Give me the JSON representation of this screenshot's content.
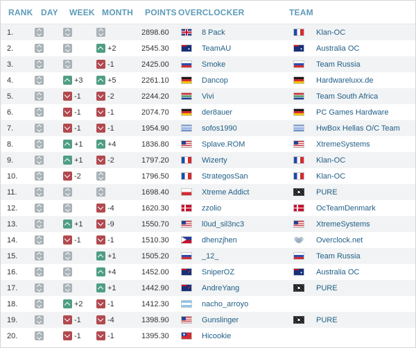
{
  "headers": {
    "rank": "RANK",
    "day": "DAY",
    "week": "WEEK",
    "month": "MONTH",
    "points": "POINTS",
    "overclocker": "OVERCLOCKER",
    "team": "TEAM"
  },
  "rows": [
    {
      "rank": "1.",
      "day": {
        "dir": "same",
        "delta": ""
      },
      "week": {
        "dir": "same",
        "delta": ""
      },
      "month": {
        "dir": "same",
        "delta": ""
      },
      "points": "2898.60",
      "oc_flag": "gb",
      "overclocker": "8 Pack",
      "team_flag": "fr",
      "team": "Klan-OC"
    },
    {
      "rank": "2.",
      "day": {
        "dir": "same",
        "delta": ""
      },
      "week": {
        "dir": "same",
        "delta": ""
      },
      "month": {
        "dir": "up",
        "delta": "+2"
      },
      "points": "2545.30",
      "oc_flag": "au",
      "overclocker": "TeamAU",
      "team_flag": "au",
      "team": "Australia OC"
    },
    {
      "rank": "3.",
      "day": {
        "dir": "same",
        "delta": ""
      },
      "week": {
        "dir": "same",
        "delta": ""
      },
      "month": {
        "dir": "down",
        "delta": "-1"
      },
      "points": "2425.00",
      "oc_flag": "ru",
      "overclocker": "Smoke",
      "team_flag": "ru",
      "team": "Team Russia"
    },
    {
      "rank": "4.",
      "day": {
        "dir": "same",
        "delta": ""
      },
      "week": {
        "dir": "up",
        "delta": "+3"
      },
      "month": {
        "dir": "up",
        "delta": "+5"
      },
      "points": "2261.10",
      "oc_flag": "de",
      "overclocker": "Dancop",
      "team_flag": "de",
      "team": "Hardwareluxx.de"
    },
    {
      "rank": "5.",
      "day": {
        "dir": "same",
        "delta": ""
      },
      "week": {
        "dir": "down",
        "delta": "-1"
      },
      "month": {
        "dir": "down",
        "delta": "-2"
      },
      "points": "2244.20",
      "oc_flag": "za",
      "overclocker": "Vivi",
      "team_flag": "za",
      "team": "Team South Africa"
    },
    {
      "rank": "6.",
      "day": {
        "dir": "same",
        "delta": ""
      },
      "week": {
        "dir": "down",
        "delta": "-1"
      },
      "month": {
        "dir": "down",
        "delta": "-1"
      },
      "points": "2074.70",
      "oc_flag": "de",
      "overclocker": "der8auer",
      "team_flag": "de",
      "team": "PC Games Hardware"
    },
    {
      "rank": "7.",
      "day": {
        "dir": "same",
        "delta": ""
      },
      "week": {
        "dir": "down",
        "delta": "-1"
      },
      "month": {
        "dir": "down",
        "delta": "-1"
      },
      "points": "1954.90",
      "oc_flag": "gr",
      "overclocker": "sofos1990",
      "team_flag": "gr",
      "team": "HwBox Hellas O/C Team"
    },
    {
      "rank": "8.",
      "day": {
        "dir": "same",
        "delta": ""
      },
      "week": {
        "dir": "up",
        "delta": "+1"
      },
      "month": {
        "dir": "up",
        "delta": "+4"
      },
      "points": "1836.80",
      "oc_flag": "us",
      "overclocker": "Splave.ROM",
      "team_flag": "us",
      "team": "XtremeSystems"
    },
    {
      "rank": "9.",
      "day": {
        "dir": "same",
        "delta": ""
      },
      "week": {
        "dir": "up",
        "delta": "+1"
      },
      "month": {
        "dir": "down",
        "delta": "-2"
      },
      "points": "1797.20",
      "oc_flag": "fr",
      "overclocker": "Wizerty",
      "team_flag": "fr",
      "team": "Klan-OC"
    },
    {
      "rank": "10.",
      "day": {
        "dir": "same",
        "delta": ""
      },
      "week": {
        "dir": "down",
        "delta": "-2"
      },
      "month": {
        "dir": "same",
        "delta": ""
      },
      "points": "1796.50",
      "oc_flag": "fr",
      "overclocker": "StrategosSan",
      "team_flag": "fr",
      "team": "Klan-OC"
    },
    {
      "rank": "11.",
      "day": {
        "dir": "same",
        "delta": ""
      },
      "week": {
        "dir": "same",
        "delta": ""
      },
      "month": {
        "dir": "same",
        "delta": ""
      },
      "points": "1698.40",
      "oc_flag": "pl",
      "overclocker": "Xtreme Addict",
      "team_flag": "pure",
      "team": "PURE"
    },
    {
      "rank": "12.",
      "day": {
        "dir": "same",
        "delta": ""
      },
      "week": {
        "dir": "same",
        "delta": ""
      },
      "month": {
        "dir": "down",
        "delta": "-4"
      },
      "points": "1620.30",
      "oc_flag": "dk",
      "overclocker": "zzolio",
      "team_flag": "dk",
      "team": "OcTeamDenmark"
    },
    {
      "rank": "13.",
      "day": {
        "dir": "same",
        "delta": ""
      },
      "week": {
        "dir": "up",
        "delta": "+1"
      },
      "month": {
        "dir": "down",
        "delta": "-9"
      },
      "points": "1550.70",
      "oc_flag": "us",
      "overclocker": "l0ud_sil3nc3",
      "team_flag": "us",
      "team": "XtremeSystems"
    },
    {
      "rank": "14.",
      "day": {
        "dir": "same",
        "delta": ""
      },
      "week": {
        "dir": "down",
        "delta": "-1"
      },
      "month": {
        "dir": "down",
        "delta": "-1"
      },
      "points": "1510.30",
      "oc_flag": "ph",
      "overclocker": "dhenzjhen",
      "team_flag": "oc",
      "team": "Overclock.net"
    },
    {
      "rank": "15.",
      "day": {
        "dir": "same",
        "delta": ""
      },
      "week": {
        "dir": "same",
        "delta": ""
      },
      "month": {
        "dir": "up",
        "delta": "+1"
      },
      "points": "1505.20",
      "oc_flag": "ru",
      "overclocker": "_12_",
      "team_flag": "ru",
      "team": "Team Russia"
    },
    {
      "rank": "16.",
      "day": {
        "dir": "same",
        "delta": ""
      },
      "week": {
        "dir": "same",
        "delta": ""
      },
      "month": {
        "dir": "up",
        "delta": "+4"
      },
      "points": "1452.00",
      "oc_flag": "nz",
      "overclocker": "SniperOZ",
      "team_flag": "au",
      "team": "Australia OC"
    },
    {
      "rank": "17.",
      "day": {
        "dir": "same",
        "delta": ""
      },
      "week": {
        "dir": "same",
        "delta": ""
      },
      "month": {
        "dir": "up",
        "delta": "+1"
      },
      "points": "1442.90",
      "oc_flag": "nz",
      "overclocker": "AndreYang",
      "team_flag": "pure",
      "team": "PURE"
    },
    {
      "rank": "18.",
      "day": {
        "dir": "same",
        "delta": ""
      },
      "week": {
        "dir": "up",
        "delta": "+2"
      },
      "month": {
        "dir": "down",
        "delta": "-1"
      },
      "points": "1412.30",
      "oc_flag": "ar",
      "overclocker": "nacho_arroyo",
      "team_flag": "",
      "team": ""
    },
    {
      "rank": "19.",
      "day": {
        "dir": "same",
        "delta": ""
      },
      "week": {
        "dir": "down",
        "delta": "-1"
      },
      "month": {
        "dir": "down",
        "delta": "-4"
      },
      "points": "1398.90",
      "oc_flag": "us",
      "overclocker": "Gunslinger",
      "team_flag": "pure",
      "team": "PURE"
    },
    {
      "rank": "20.",
      "day": {
        "dir": "same",
        "delta": ""
      },
      "week": {
        "dir": "down",
        "delta": "-1"
      },
      "month": {
        "dir": "down",
        "delta": "-1"
      },
      "points": "1395.30",
      "oc_flag": "tw",
      "overclocker": "Hicookie",
      "team_flag": "",
      "team": ""
    }
  ]
}
